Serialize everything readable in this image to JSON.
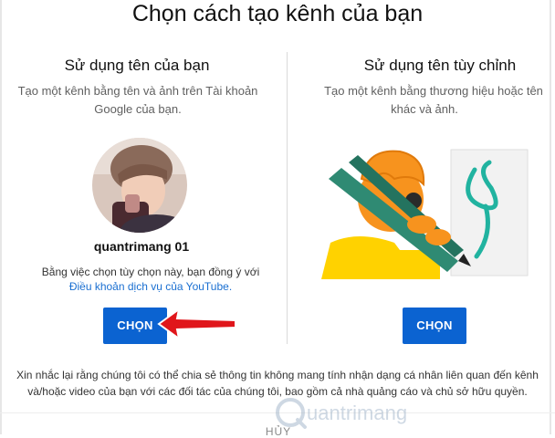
{
  "dialog": {
    "title": "Chọn cách tạo kênh của bạn",
    "cancel_label": "HỦY"
  },
  "left_option": {
    "heading": "Sử dụng tên của bạn",
    "description_line1": "Tạo một kênh bằng tên và ảnh trên Tài khoản",
    "description_line2": "Google của bạn.",
    "username": "quantrimang 01",
    "terms_text": "Bằng việc chọn tùy chọn này, bạn đồng ý với",
    "terms_link": "Điều khoản dịch vụ của YouTube.",
    "button_label": "CHỌN"
  },
  "right_option": {
    "heading": "Sử dụng tên tùy chỉnh",
    "description_line1": "Tạo một kênh bằng thương hiệu hoặc tên",
    "description_line2": "khác và ảnh.",
    "button_label": "CHỌN"
  },
  "notice": {
    "line1": "Xin nhắc lại rằng chúng tôi có thể chia sẻ thông tin không mang tính nhận dạng cá nhân liên quan đến kênh",
    "line2": "và/hoặc video của bạn với các đối tác của chúng tôi, bao gồm cả nhà quảng cáo và chủ sở hữu quyền."
  },
  "watermark": {
    "text": "uantrimang"
  },
  "colors": {
    "button": "#0b63d1",
    "link": "#1a6fd1",
    "arrow": "#e0161b"
  },
  "icons": [
    "avatar-photo",
    "custom-name-illustration",
    "red-arrow-annotation"
  ]
}
